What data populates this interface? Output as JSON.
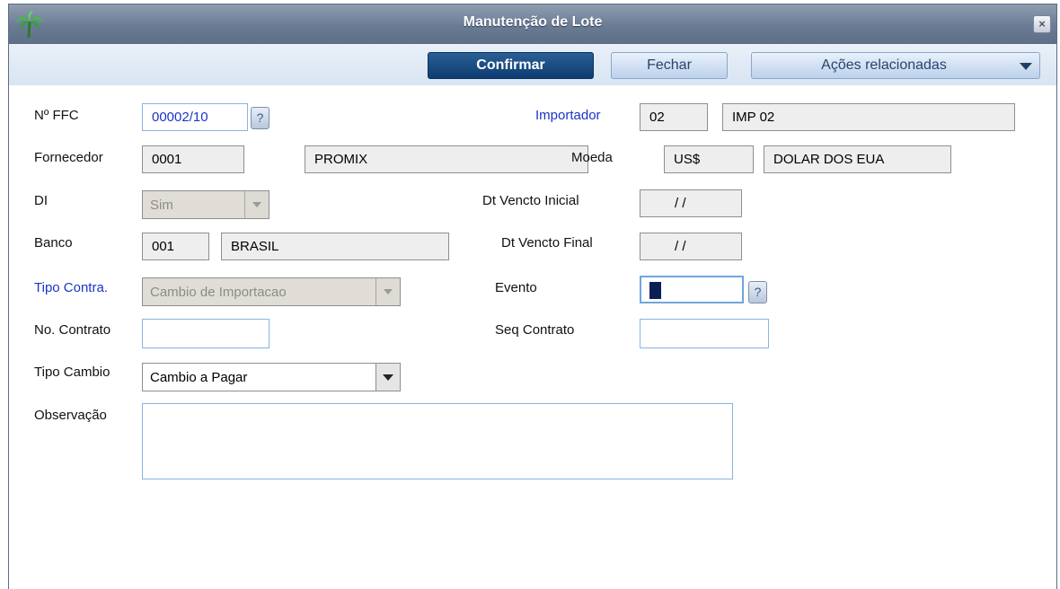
{
  "window": {
    "title": "Manutenção de Lote",
    "close_label": "×"
  },
  "toolbar": {
    "confirm_label": "Confirmar",
    "close_label": "Fechar",
    "actions_label": "Ações relacionadas"
  },
  "form": {
    "ffc": {
      "label": "Nº FFC",
      "value": "00002/10",
      "help": "?"
    },
    "importador": {
      "label": "Importador",
      "code": "02",
      "name": "IMP 02"
    },
    "fornecedor": {
      "label": "Fornecedor",
      "code": "0001",
      "name": "PROMIX"
    },
    "moeda": {
      "label": "Moeda",
      "code": "US$",
      "name": "DOLAR DOS EUA"
    },
    "di": {
      "label": "DI",
      "value": "Sim"
    },
    "dt_vencto_inicial": {
      "label": "Dt Vencto Inicial",
      "value": "/ /"
    },
    "banco": {
      "label": "Banco",
      "code": "001",
      "name": "BRASIL"
    },
    "dt_vencto_final": {
      "label": "Dt Vencto Final",
      "value": "/ /"
    },
    "tipo_contra": {
      "label": "Tipo Contra.",
      "value": "Cambio de Importacao"
    },
    "evento": {
      "label": "Evento",
      "value": "",
      "help": "?"
    },
    "no_contrato": {
      "label": "No. Contrato",
      "value": ""
    },
    "seq_contrato": {
      "label": "Seq Contrato",
      "value": ""
    },
    "tipo_cambio": {
      "label": "Tipo Cambio",
      "value": "Cambio a Pagar"
    },
    "observacao": {
      "label": "Observação",
      "value": ""
    }
  }
}
